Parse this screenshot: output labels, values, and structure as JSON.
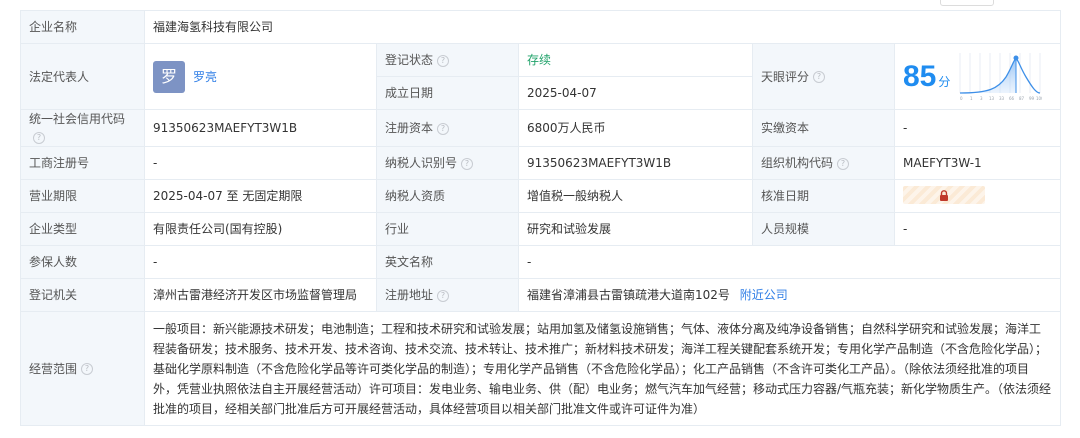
{
  "company": {
    "name_label": "企业名称",
    "name": "福建海氢科技有限公司"
  },
  "legal_rep": {
    "label": "法定代表人",
    "avatar_char": "罗",
    "name": "罗亮"
  },
  "reg_status": {
    "label": "登记状态",
    "value": "存续"
  },
  "established": {
    "label": "成立日期",
    "value": "2025-04-07"
  },
  "tianyan": {
    "label": "天眼评分",
    "score": "85",
    "unit": "分",
    "chart_ticks": [
      "0",
      "1",
      "3",
      "13",
      "33",
      "66",
      "87",
      "99",
      "100"
    ]
  },
  "credit_code": {
    "label": "统一社会信用代码",
    "value": "91350623MAEFYT3W1B"
  },
  "reg_capital": {
    "label": "注册资本",
    "value": "6800万人民币"
  },
  "paid_capital": {
    "label": "实缴资本",
    "value": "-"
  },
  "biz_reg_no": {
    "label": "工商注册号",
    "value": "-"
  },
  "taxpayer_id": {
    "label": "纳税人识别号",
    "value": "91350623MAEFYT3W1B"
  },
  "org_code": {
    "label": "组织机构代码",
    "value": "MAEFYT3W-1"
  },
  "biz_term": {
    "label": "营业期限",
    "value": "2025-04-07 至 无固定期限"
  },
  "taxpayer_qual": {
    "label": "纳税人资质",
    "value": "增值税一般纳税人"
  },
  "approval_date": {
    "label": "核准日期"
  },
  "company_type": {
    "label": "企业类型",
    "value": "有限责任公司(国有控股)"
  },
  "industry": {
    "label": "行业",
    "value": "研究和试验发展"
  },
  "staff_size": {
    "label": "人员规模",
    "value": "-"
  },
  "insured": {
    "label": "参保人数",
    "value": "-"
  },
  "english_name": {
    "label": "英文名称",
    "value": "-"
  },
  "reg_authority": {
    "label": "登记机关",
    "value": "漳州古雷港经济开发区市场监督管理局"
  },
  "reg_address": {
    "label": "注册地址",
    "value": "福建省漳浦县古雷镇疏港大道南102号",
    "link": "附近公司"
  },
  "scope": {
    "label": "经营范围",
    "text": "一般项目：新兴能源技术研发；电池制造；工程和技术研究和试验发展；站用加氢及储氢设施销售；气体、液体分离及纯净设备销售；自然科学研究和试验发展；海洋工程装备研发；技术服务、技术开发、技术咨询、技术交流、技术转让、技术推广；新材料技术研发；海洋工程关键配套系统开发；专用化学产品制造（不含危险化学品）；基础化学原料制造（不含危险化学品等许可类化学品的制造）；专用化学产品销售（不含危险化学品）；化工产品销售（不含许可类化工产品）。（除依法须经批准的项目外，凭营业执照依法自主开展经营活动）许可项目：发电业务、输电业务、供（配）电业务；燃气汽车加气经营；移动式压力容器/气瓶充装；新化学物质生产。（依法须经批准的项目，经相关部门批准后方可开展经营活动，具体经营项目以相关部门批准文件或许可证件为准）"
  },
  "colors": {
    "label_bg": "#f3f7fb",
    "border": "#e6ecf2",
    "link": "#2f7ee6",
    "status": "#22a36b",
    "score": "#1f8cf0"
  }
}
